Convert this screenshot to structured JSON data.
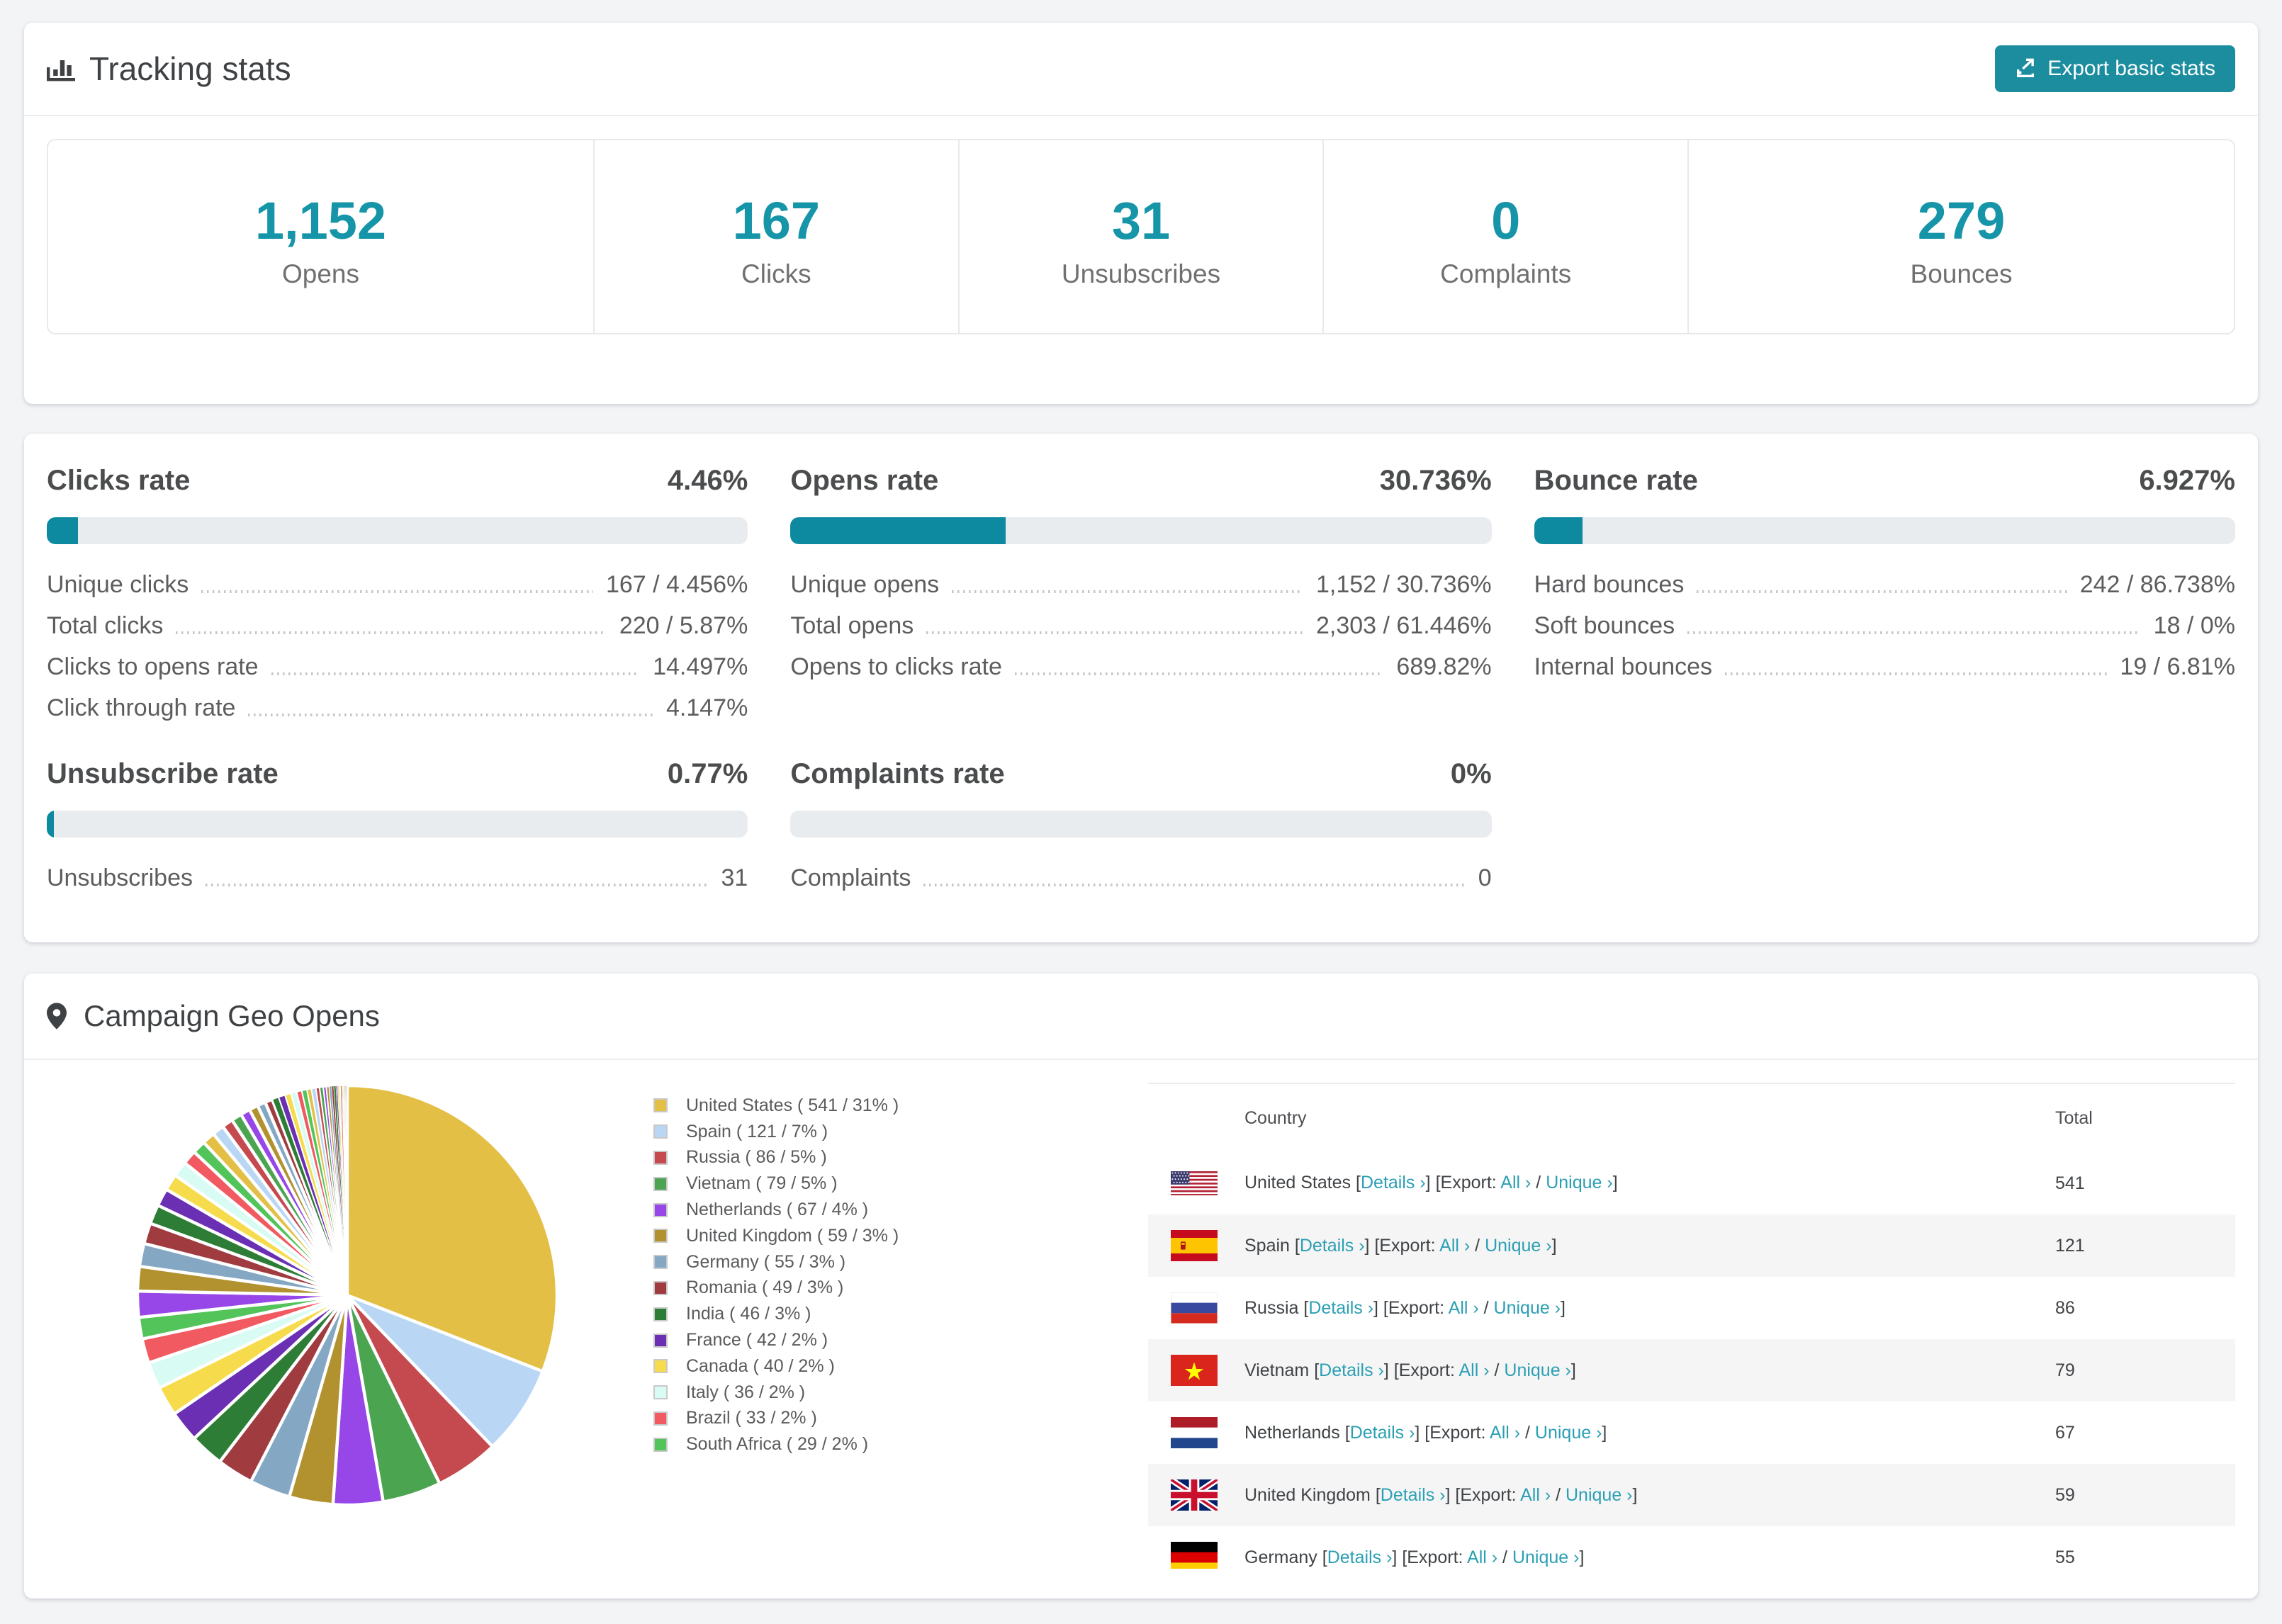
{
  "theme": {
    "accent_teal": "#1795a8",
    "bar_fill": "#0d89a0",
    "button_bg": "#1b8d9f",
    "link_teal": "#2b9fb4",
    "bar_track": "#e9ecef"
  },
  "tracking_stats": {
    "title": "Tracking stats",
    "export_button_label": "Export basic stats",
    "summary": [
      {
        "value": "1,152",
        "label": "Opens"
      },
      {
        "value": "167",
        "label": "Clicks"
      },
      {
        "value": "31",
        "label": "Unsubscribes"
      },
      {
        "value": "0",
        "label": "Complaints"
      },
      {
        "value": "279",
        "label": "Bounces"
      }
    ]
  },
  "rates": {
    "sections": [
      {
        "title": "Clicks rate",
        "percent": "4.46%",
        "fill": 4.46,
        "row": 1,
        "rows": [
          {
            "label": "Unique clicks",
            "value": "167 / 4.456%"
          },
          {
            "label": "Total clicks",
            "value": "220 / 5.87%"
          },
          {
            "label": "Clicks to opens rate",
            "value": "14.497%"
          },
          {
            "label": "Click through rate",
            "value": "4.147%"
          }
        ]
      },
      {
        "title": "Opens rate",
        "percent": "30.736%",
        "fill": 30.736,
        "row": 1,
        "rows": [
          {
            "label": "Unique opens",
            "value": "1,152 / 30.736%"
          },
          {
            "label": "Total opens",
            "value": "2,303 / 61.446%"
          },
          {
            "label": "Opens to clicks rate",
            "value": "689.82%"
          }
        ]
      },
      {
        "title": "Bounce rate",
        "percent": "6.927%",
        "fill": 6.927,
        "row": 1,
        "rows": [
          {
            "label": "Hard bounces",
            "value": "242 / 86.738%"
          },
          {
            "label": "Soft bounces",
            "value": "18 / 0%"
          },
          {
            "label": "Internal bounces",
            "value": "19 / 6.81%"
          }
        ]
      },
      {
        "title": "Unsubscribe rate",
        "percent": "0.77%",
        "fill": 0.77,
        "row": 2,
        "rows": [
          {
            "label": "Unsubscribes",
            "value": "31"
          }
        ]
      },
      {
        "title": "Complaints rate",
        "percent": "0%",
        "fill": 0,
        "row": 2,
        "rows": [
          {
            "label": "Complaints",
            "value": "0"
          }
        ]
      }
    ]
  },
  "geo": {
    "title": "Campaign Geo Opens",
    "table": {
      "headers": {
        "country": "Country",
        "total": "Total"
      },
      "link_labels": {
        "details": "Details ›",
        "export_prefix": "Export:",
        "all": "All ›",
        "unique": "Unique ›",
        "slash": "/"
      },
      "rows": [
        {
          "flag": "us",
          "country": "United States",
          "total": "541"
        },
        {
          "flag": "es",
          "country": "Spain",
          "total": "121"
        },
        {
          "flag": "ru",
          "country": "Russia",
          "total": "86"
        },
        {
          "flag": "vn",
          "country": "Vietnam",
          "total": "79"
        },
        {
          "flag": "nl",
          "country": "Netherlands",
          "total": "67"
        },
        {
          "flag": "gb",
          "country": "United Kingdom",
          "total": "59"
        },
        {
          "flag": "de",
          "country": "Germany",
          "total": "55"
        }
      ]
    }
  },
  "chart_data": {
    "type": "pie",
    "title": "Campaign Geo Opens",
    "legend_position": "right",
    "series": [
      {
        "label": "United States",
        "value": 541,
        "pct": "31%",
        "color": "#e3bf46"
      },
      {
        "label": "Spain",
        "value": 121,
        "pct": "7%",
        "color": "#b9d7f5"
      },
      {
        "label": "Russia",
        "value": 86,
        "pct": "5%",
        "color": "#c44a50"
      },
      {
        "label": "Vietnam",
        "value": 79,
        "pct": "5%",
        "color": "#4aa450"
      },
      {
        "label": "Netherlands",
        "value": 67,
        "pct": "4%",
        "color": "#9747e8"
      },
      {
        "label": "United Kingdom",
        "value": 59,
        "pct": "3%",
        "color": "#b2922f"
      },
      {
        "label": "Germany",
        "value": 55,
        "pct": "3%",
        "color": "#84a7c4"
      },
      {
        "label": "Romania",
        "value": 49,
        "pct": "3%",
        "color": "#a03c40"
      },
      {
        "label": "India",
        "value": 46,
        "pct": "3%",
        "color": "#2e7d36"
      },
      {
        "label": "France",
        "value": 42,
        "pct": "2%",
        "color": "#6a2fb3"
      },
      {
        "label": "Canada",
        "value": 40,
        "pct": "2%",
        "color": "#f6dc4c"
      },
      {
        "label": "Italy",
        "value": 36,
        "pct": "2%",
        "color": "#d8fbf4"
      },
      {
        "label": "Brazil",
        "value": 33,
        "pct": "2%",
        "color": "#f05a60"
      },
      {
        "label": "South Africa",
        "value": 29,
        "pct": "2%",
        "color": "#52c45a"
      }
    ],
    "other_slices": [
      35,
      33,
      31,
      28,
      26,
      24,
      22,
      21,
      19,
      18,
      17,
      16,
      15,
      14,
      13,
      12,
      11,
      10,
      9,
      9,
      8,
      8,
      7,
      7,
      6,
      6,
      5,
      5,
      4,
      4,
      3,
      3,
      3,
      2,
      2,
      2,
      2,
      1,
      1,
      1,
      1,
      1,
      1,
      1
    ]
  }
}
